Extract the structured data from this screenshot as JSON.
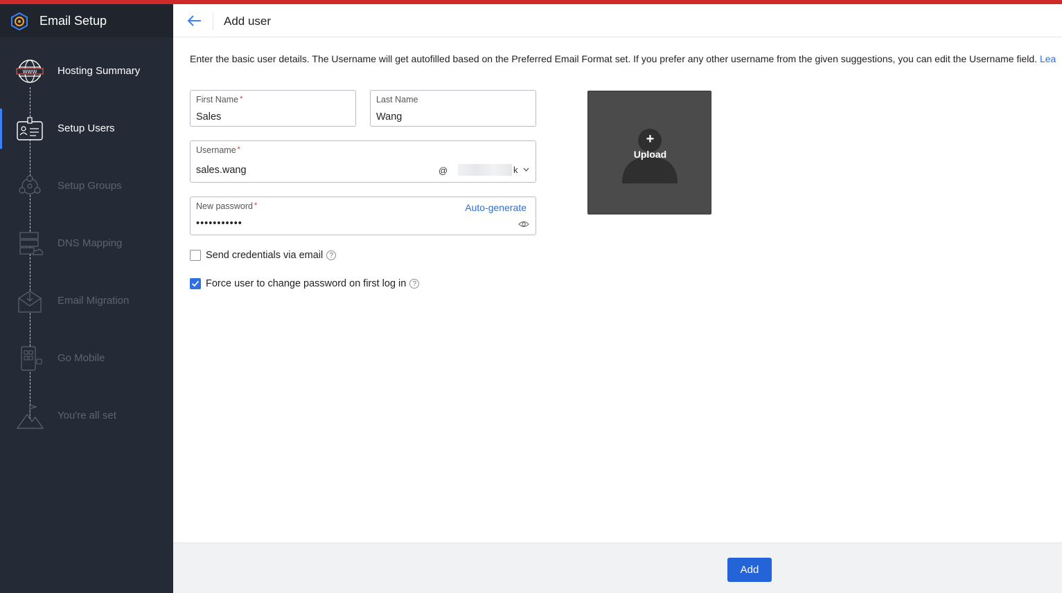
{
  "app": {
    "title": "Email Setup"
  },
  "sidebar": {
    "steps": [
      {
        "label": "Hosting Summary",
        "icon": "globe-www-icon",
        "state": "done"
      },
      {
        "label": "Setup Users",
        "icon": "user-card-icon",
        "state": "active"
      },
      {
        "label": "Setup Groups",
        "icon": "group-network-icon",
        "state": "pending"
      },
      {
        "label": "DNS Mapping",
        "icon": "server-cloud-icon",
        "state": "pending"
      },
      {
        "label": "Email Migration",
        "icon": "envelope-download-icon",
        "state": "pending"
      },
      {
        "label": "Go Mobile",
        "icon": "mobile-qr-icon",
        "state": "pending"
      },
      {
        "label": "You're all set",
        "icon": "mountain-flag-icon",
        "state": "pending"
      }
    ]
  },
  "header": {
    "title": "Add user"
  },
  "intro": {
    "text": "Enter the basic user details. The Username will get autofilled based on the Preferred Email Format set. If you prefer any other username from the given suggestions, you can edit the Username field.",
    "link": "Lea"
  },
  "form": {
    "first_name": {
      "label": "First Name",
      "required": "*",
      "value": "Sales"
    },
    "last_name": {
      "label": "Last Name",
      "value": "Wang"
    },
    "username": {
      "label": "Username",
      "required": "*",
      "value": "sales.wang",
      "at": "@",
      "domain_tail": "k"
    },
    "password": {
      "label": "New password",
      "required": "*",
      "value": "•••••••••••",
      "auto_generate": "Auto-generate"
    },
    "send_credentials": {
      "label": "Send credentials via email",
      "checked": false,
      "help": "?"
    },
    "force_change": {
      "label": "Force user to change password on first log in",
      "checked": true,
      "help": "?"
    }
  },
  "upload": {
    "label": "Upload",
    "plus": "+"
  },
  "footer": {
    "add_label": "Add"
  },
  "colors": {
    "accent": "#cf2a2a",
    "primary": "#2563d9",
    "sidebar_bg": "#252b36",
    "link": "#2d6fd9"
  }
}
